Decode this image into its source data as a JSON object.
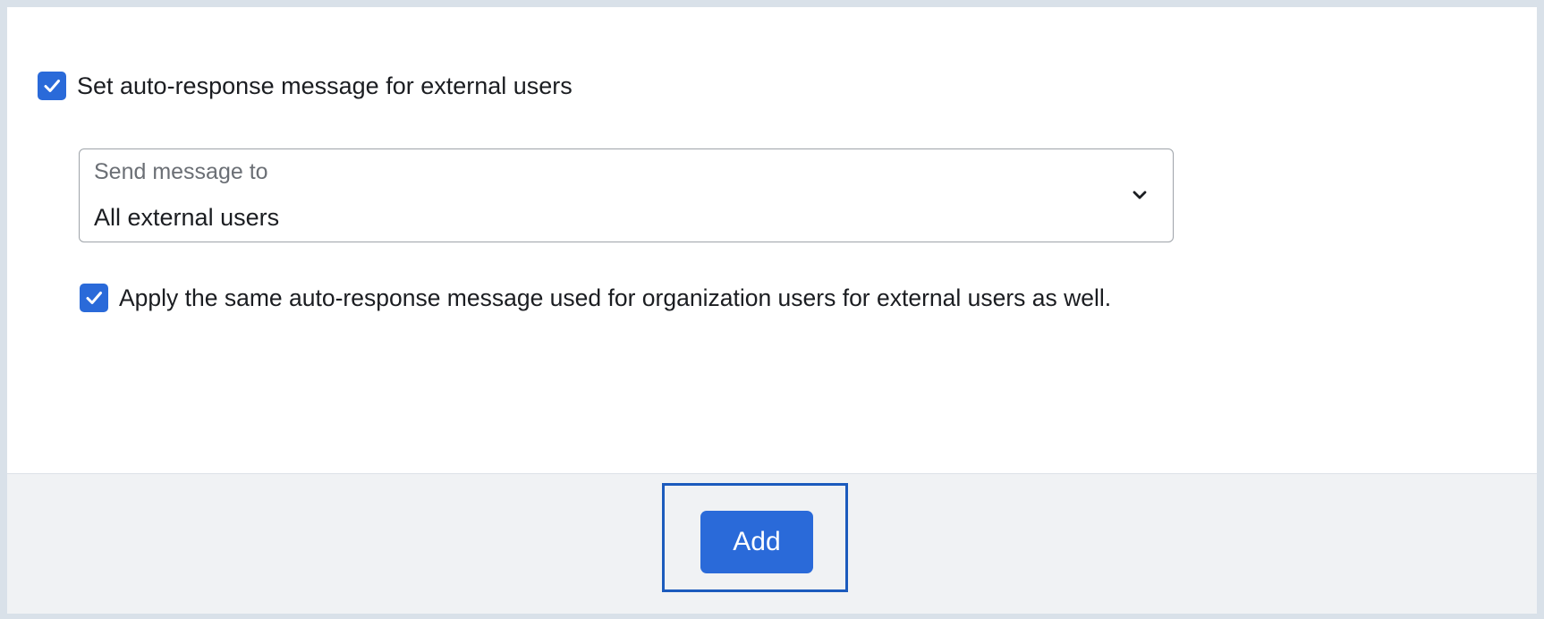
{
  "external_response": {
    "enable_label": "Set auto-response message for external users",
    "enable_checked": true,
    "send_to": {
      "label": "Send message to",
      "value": "All external users"
    },
    "same_message_label": "Apply the same auto-response message used for organization users for external users as well.",
    "same_message_checked": true
  },
  "footer": {
    "add_label": "Add"
  },
  "colors": {
    "accent": "#2a6ad9",
    "highlight_border": "#1c5bbd",
    "footer_bg": "#f0f2f4"
  },
  "icons": {
    "checkbox": "checkmark-icon",
    "dropdown": "chevron-down-icon"
  }
}
